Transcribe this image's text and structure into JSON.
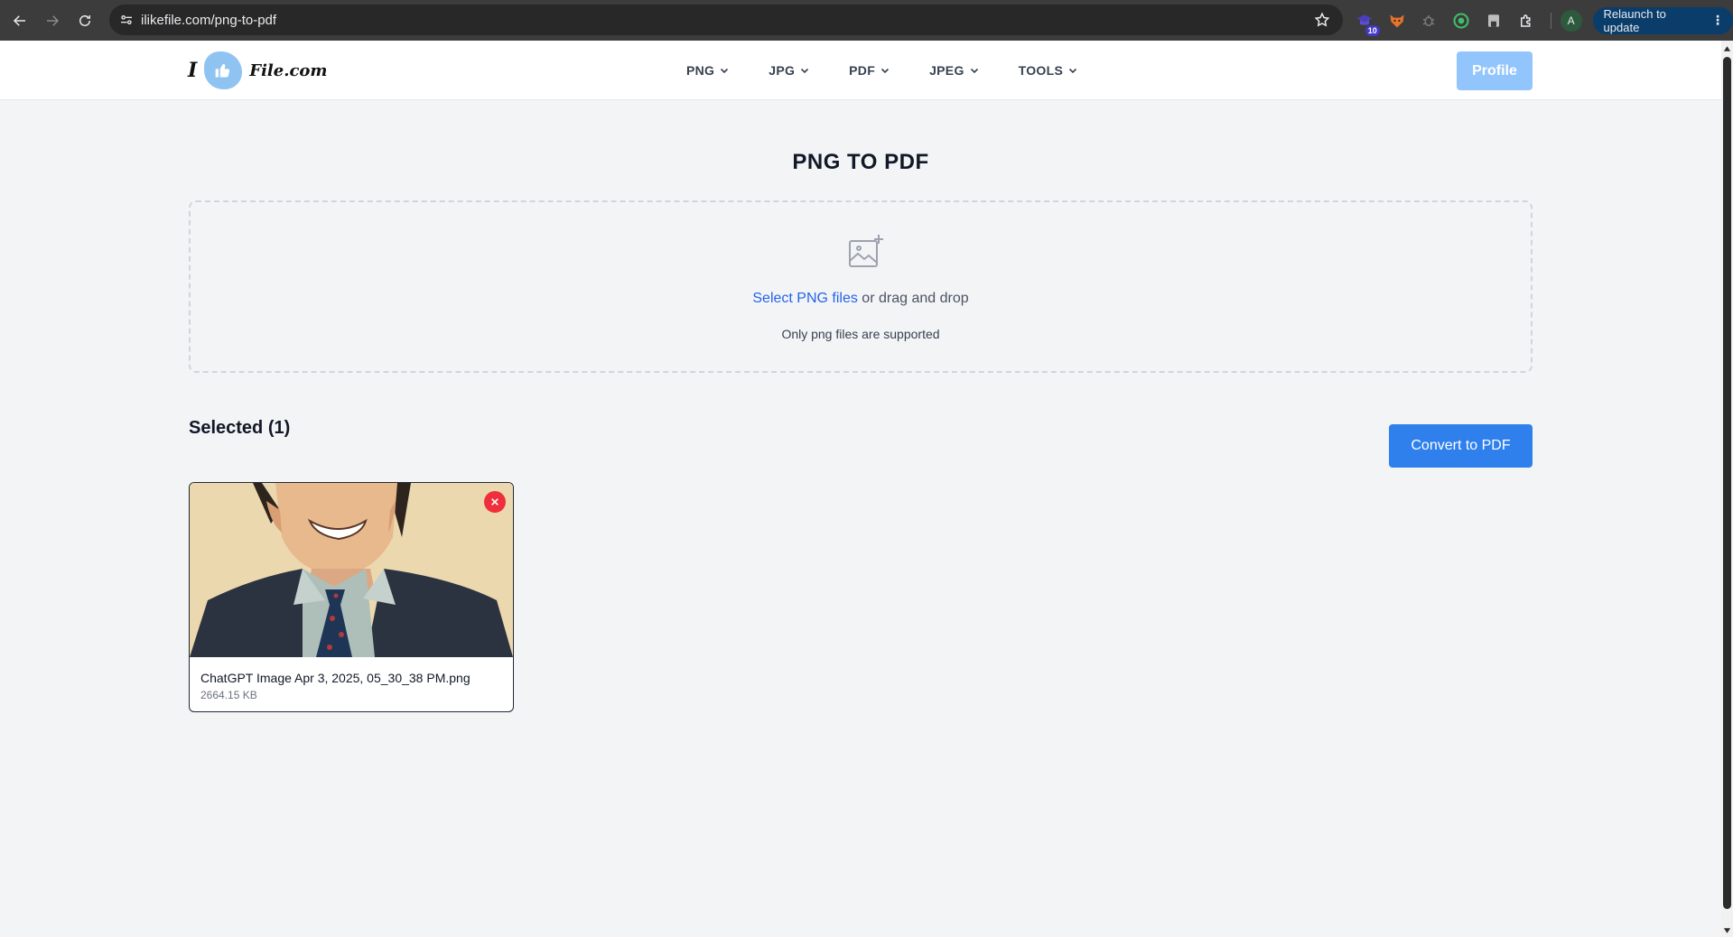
{
  "browser": {
    "url": "ilikefile.com/png-to-pdf",
    "extension_badge": "10",
    "profile_initial": "A",
    "relaunch_label": "Relaunch to update"
  },
  "header": {
    "logo_left": "I",
    "logo_right": "File.com",
    "nav": [
      {
        "label": "PNG"
      },
      {
        "label": "JPG"
      },
      {
        "label": "PDF"
      },
      {
        "label": "JPEG"
      },
      {
        "label": "TOOLS"
      }
    ],
    "profile_label": "Profile"
  },
  "page": {
    "title": "PNG TO PDF",
    "dropzone": {
      "link": "Select PNG files",
      "text": " or drag and drop",
      "note": "Only png files are supported"
    },
    "selected_heading": "Selected (1)",
    "convert_label": "Convert to PDF",
    "files": [
      {
        "name": "ChatGPT Image Apr 3, 2025, 05_30_38 PM.png",
        "size": "2664.15 KB"
      }
    ]
  },
  "colors": {
    "primary": "#2f80ed",
    "profile_disabled": "#93c5fd",
    "remove": "#ef2f3c",
    "link": "#2563eb"
  },
  "icons": [
    "back-icon",
    "forward-icon",
    "reload-icon",
    "site-info-icon",
    "star-icon",
    "image-plus-icon",
    "close-icon",
    "chevron-down-icon"
  ]
}
